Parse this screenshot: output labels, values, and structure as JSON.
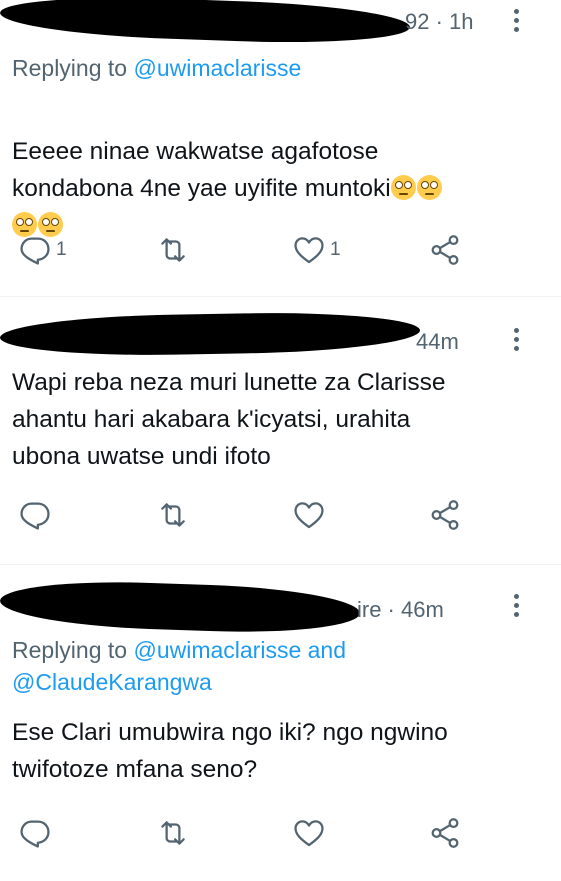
{
  "tweets": [
    {
      "time": "92 · 1h",
      "replying_prefix": "Replying to",
      "replying_handle": "@uwimaclarisse",
      "text": "Eeeee ninae wakwatse agafotose\nkondabona 4ne yae uyifite muntoki",
      "reply_count": "1",
      "like_count": "1"
    },
    {
      "time": "44m",
      "text": "Wapi reba neza muri lunette za Clarisse\nahantu hari akabara k'icyatsi, urahita\nubona uwatse undi ifoto"
    },
    {
      "time": "ire · 46m",
      "replying_prefix": "Replying to",
      "replying_handle": "@uwimaclarisse and",
      "replying_handle2": "@ClaudeKarangwa",
      "text": "Ese Clari umubwira ngo iki? ngo ngwino\ntwifotoze mfana seno?"
    }
  ],
  "icons": {
    "reply": "reply-icon",
    "retweet": "retweet-icon",
    "like": "like-icon",
    "share": "share-icon",
    "more": "more-icon",
    "emoji": "face-with-rolling-eyes-emoji"
  },
  "colors": {
    "text": "#0f1419",
    "secondary": "#536471",
    "link": "#1d9bf0",
    "divider": "#eff3f4"
  }
}
